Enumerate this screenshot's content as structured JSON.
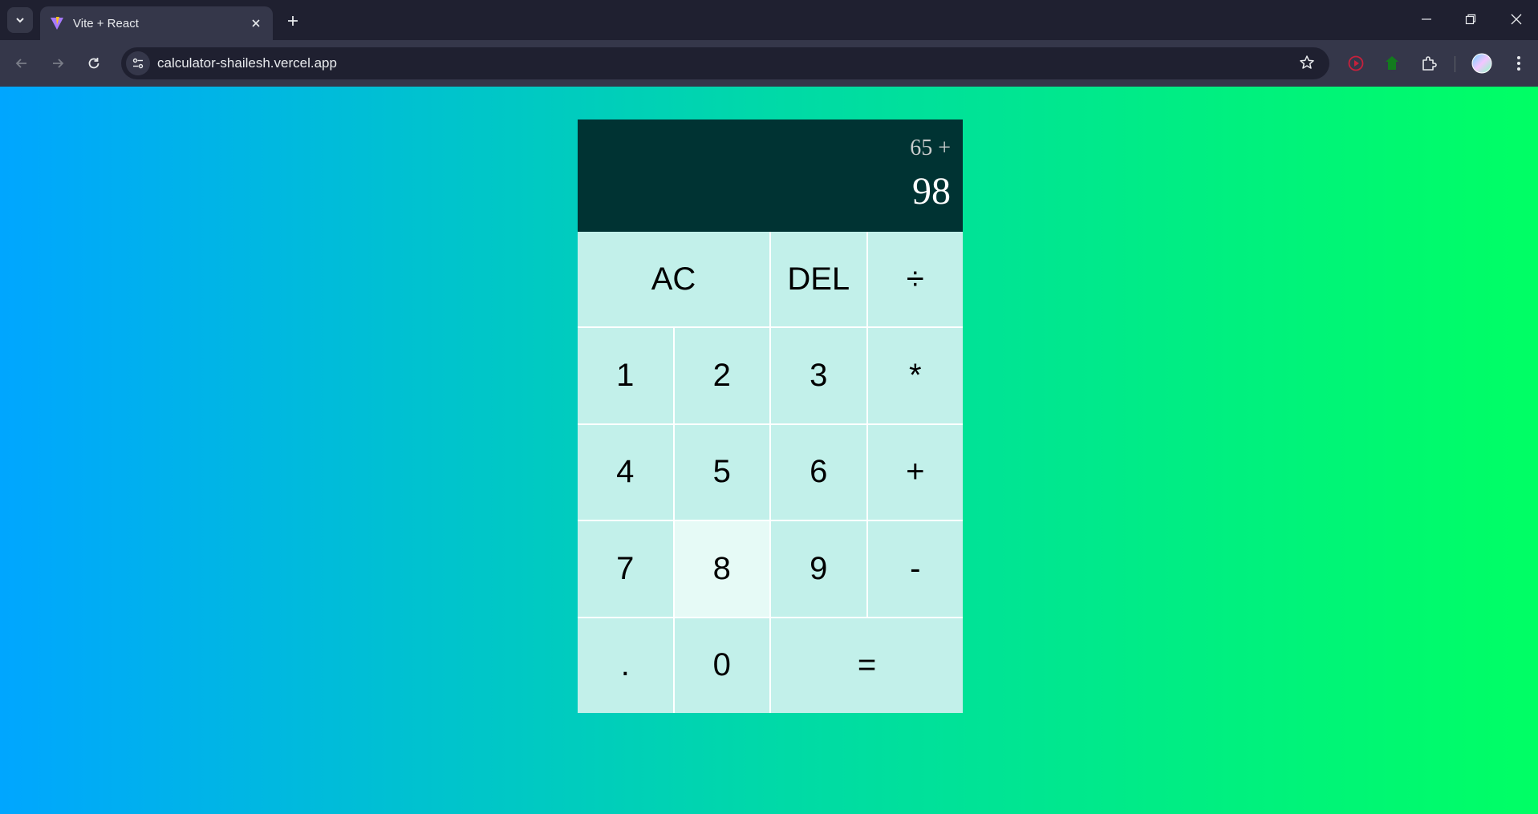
{
  "browser": {
    "tab_title": "Vite + React",
    "url": "calculator-shailesh.vercel.app"
  },
  "calculator": {
    "previous_operand": "65 +",
    "current_operand": "98",
    "keys": {
      "ac": "AC",
      "del": "DEL",
      "divide": "÷",
      "one": "1",
      "two": "2",
      "three": "3",
      "multiply": "*",
      "four": "4",
      "five": "5",
      "six": "6",
      "plus": "+",
      "seven": "7",
      "eight": "8",
      "nine": "9",
      "minus": "-",
      "dot": ".",
      "zero": "0",
      "equals": "="
    }
  },
  "colors": {
    "display_bg": "#003333",
    "key_bg": "#c2f0ea",
    "key_hover_bg": "#e6faf6",
    "gradient_start": "#00a6ff",
    "gradient_end": "#00ff64"
  }
}
